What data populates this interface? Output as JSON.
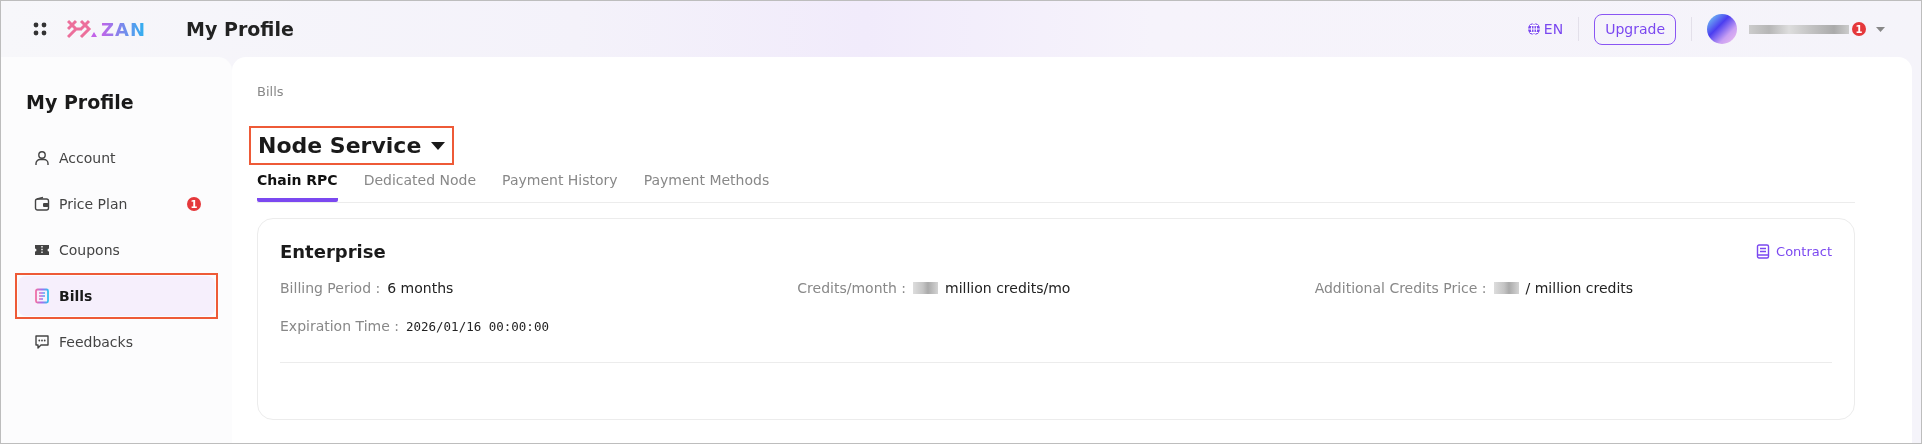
{
  "topbar": {
    "logo_text": "ZAN",
    "title": "My Profile",
    "language": "EN",
    "upgrade_button": "Upgrade",
    "notification_badge": "1"
  },
  "sidebar": {
    "title": "My Profile",
    "items": [
      {
        "label": "Account",
        "selected": false,
        "highlighted": false
      },
      {
        "label": "Price Plan",
        "badge": "1",
        "selected": false,
        "highlighted": false
      },
      {
        "label": "Coupons",
        "selected": false,
        "highlighted": false
      },
      {
        "label": "Bills",
        "selected": true,
        "highlighted": true
      },
      {
        "label": "Feedbacks",
        "selected": false,
        "highlighted": false
      }
    ]
  },
  "main": {
    "breadcrumb": "Bills",
    "service_selector": {
      "label": "Node Service",
      "highlighted": true
    },
    "tabs": [
      {
        "label": "Chain RPC",
        "selected": true
      },
      {
        "label": "Dedicated Node",
        "selected": false
      },
      {
        "label": "Payment History",
        "selected": false
      },
      {
        "label": "Payment Methods",
        "selected": false
      }
    ],
    "plan_card": {
      "title": "Enterprise",
      "contract_link": "Contract",
      "fields": [
        {
          "label": "Billing Period :",
          "value": "6 months",
          "redacted": false,
          "kind": "text"
        },
        {
          "label": "Credits/month :",
          "value": "million credits/mo",
          "redacted": true,
          "kind": "text"
        },
        {
          "label": "Additional Credits Price :",
          "value": "/ million credits",
          "redacted": true,
          "kind": "text"
        },
        {
          "label": "Expiration Time :",
          "value": "2026/01/16 00:00:00",
          "redacted": false,
          "kind": "mono"
        }
      ]
    }
  }
}
